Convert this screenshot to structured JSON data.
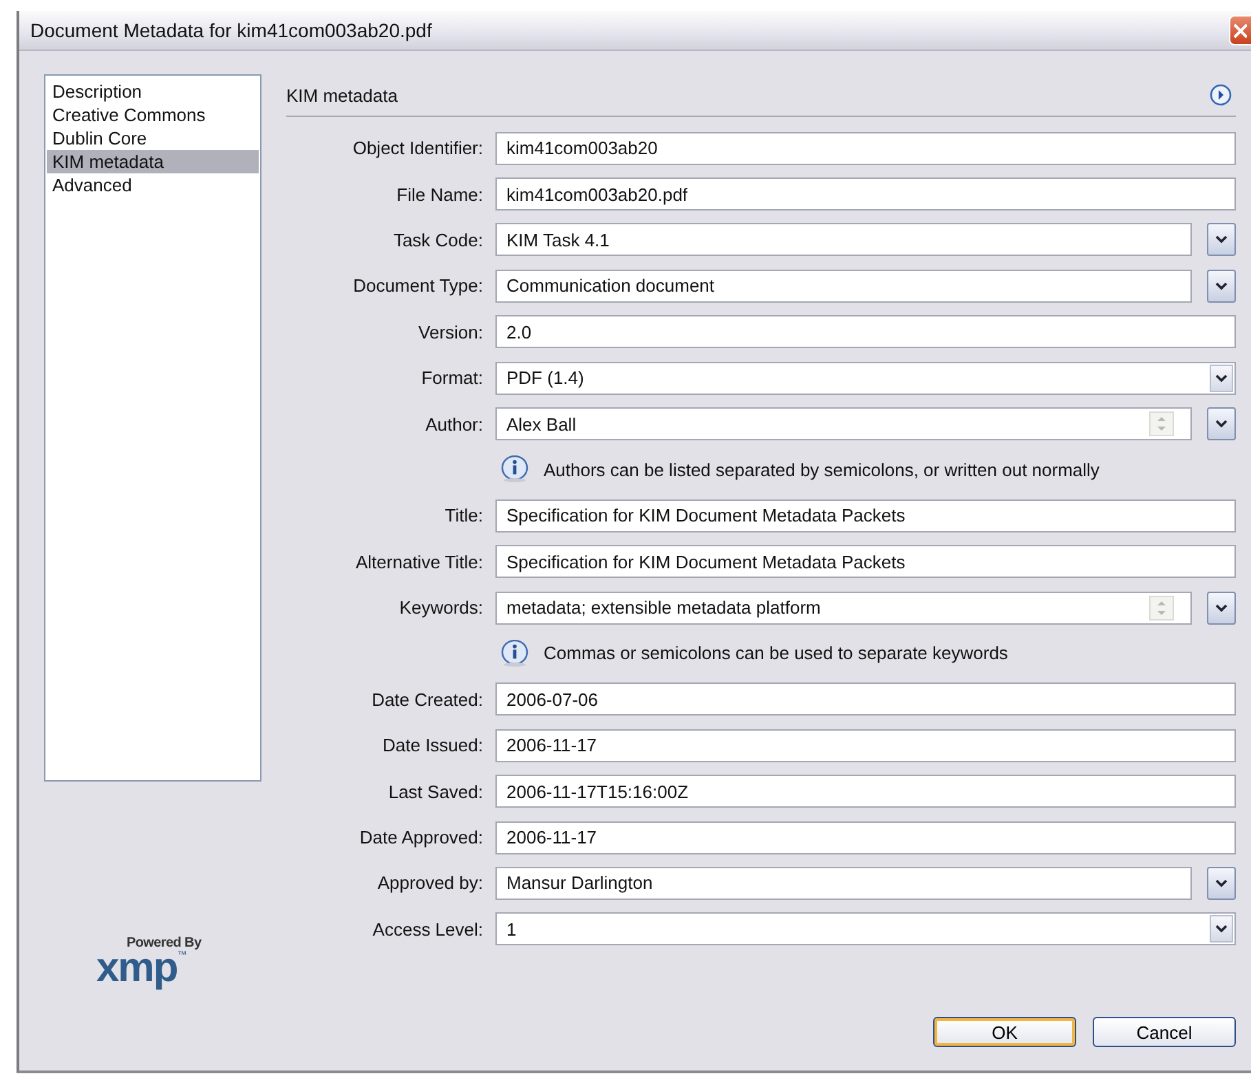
{
  "window": {
    "title": "Document Metadata for kim41com003ab20.pdf"
  },
  "sidebar": {
    "items": [
      {
        "label": "Description",
        "selected": false
      },
      {
        "label": "Creative Commons",
        "selected": false
      },
      {
        "label": "Dublin Core",
        "selected": false
      },
      {
        "label": "KIM metadata",
        "selected": true
      },
      {
        "label": "Advanced",
        "selected": false
      }
    ]
  },
  "logo": {
    "tagline": "Powered By",
    "wordmark": "xmp",
    "mark": "™"
  },
  "panel": {
    "heading": "KIM metadata"
  },
  "fields": [
    {
      "kind": "text",
      "label": "Object Identifier:",
      "value": "kim41com003ab20"
    },
    {
      "kind": "text",
      "label": "File Name:",
      "value": "kim41com003ab20.pdf"
    },
    {
      "kind": "combo",
      "label": "Task Code:",
      "value": "KIM Task 4.1"
    },
    {
      "kind": "combo",
      "label": "Document Type:",
      "value": "Communication document"
    },
    {
      "kind": "text",
      "label": "Version:",
      "value": "2.0"
    },
    {
      "kind": "select",
      "label": "Format:",
      "value": "PDF (1.4)"
    },
    {
      "kind": "multi",
      "label": "Author:",
      "value": "Alex Ball"
    },
    {
      "kind": "note",
      "text": "Authors can be listed separated by semicolons, or written out normally"
    },
    {
      "kind": "text",
      "label": "Title:",
      "value": "Specification for KIM Document Metadata Packets"
    },
    {
      "kind": "text",
      "label": "Alternative Title:",
      "value": "Specification for KIM Document Metadata Packets"
    },
    {
      "kind": "multi",
      "label": "Keywords:",
      "value": "metadata; extensible metadata platform"
    },
    {
      "kind": "note",
      "text": "Commas or semicolons can be used to separate keywords"
    },
    {
      "kind": "text",
      "label": "Date Created:",
      "value": "2006-07-06"
    },
    {
      "kind": "text",
      "label": "Date Issued:",
      "value": "2006-11-17"
    },
    {
      "kind": "text",
      "label": "Last Saved:",
      "value": "2006-11-17T15:16:00Z"
    },
    {
      "kind": "text",
      "label": "Date Approved:",
      "value": "2006-11-17"
    },
    {
      "kind": "combo",
      "label": "Approved by:",
      "value": "Mansur Darlington"
    },
    {
      "kind": "select",
      "label": "Access Level:",
      "value": "1"
    }
  ],
  "buttons": [
    {
      "label": "OK",
      "default": true
    },
    {
      "label": "Cancel",
      "default": false
    }
  ]
}
